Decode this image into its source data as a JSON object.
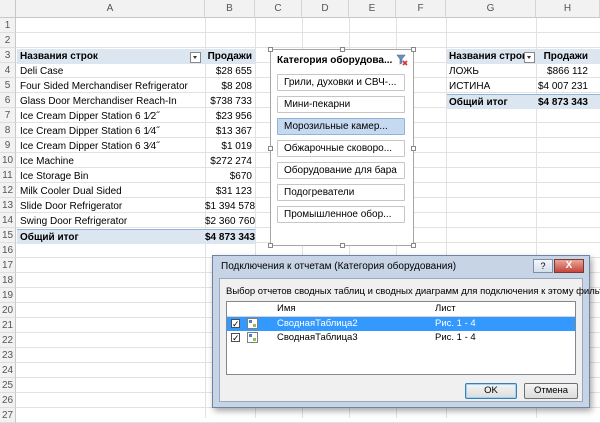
{
  "columns": [
    "A",
    "B",
    "C",
    "D",
    "E",
    "F",
    "G",
    "H"
  ],
  "rows": [
    "1",
    "2",
    "3",
    "4",
    "5",
    "6",
    "7",
    "8",
    "9",
    "10",
    "11",
    "12",
    "13",
    "14",
    "15",
    "16",
    "17",
    "18",
    "19",
    "20",
    "21",
    "22",
    "23",
    "24",
    "25",
    "26",
    "27"
  ],
  "pivot1": {
    "header_label": "Названия строк",
    "header_value": "Продажи",
    "items": [
      {
        "label": "Deli Case",
        "value": "$28 655"
      },
      {
        "label": "Four Sided Merchandiser Refrigerator",
        "value": "$8 208"
      },
      {
        "label": "Glass Door Merchandiser Reach-In",
        "value": "$738 733"
      },
      {
        "label": "Ice Cream Dipper Station 6 1⁄2˝",
        "value": "$23 956"
      },
      {
        "label": "Ice Cream Dipper Station 6 1⁄4˝",
        "value": "$13 367"
      },
      {
        "label": "Ice Cream Dipper Station 6 3⁄4˝",
        "value": "$1 019"
      },
      {
        "label": "Ice Machine",
        "value": "$272 274"
      },
      {
        "label": "Ice Storage Bin",
        "value": "$670"
      },
      {
        "label": "Milk Cooler Dual Sided",
        "value": "$31 123"
      },
      {
        "label": "Slide Door Refrigerator",
        "value": "$1 394 578"
      },
      {
        "label": "Swing Door Refrigerator",
        "value": "$2 360 760"
      }
    ],
    "total_label": "Общий итог",
    "total_value": "$4 873 343"
  },
  "pivot2": {
    "header_label": "Названия строк",
    "header_value": "Продажи",
    "items": [
      {
        "label": "ЛОЖЬ",
        "value": "$866 112"
      },
      {
        "label": "ИСТИНА",
        "value": "$4 007 231"
      }
    ],
    "total_label": "Общий итог",
    "total_value": "$4 873 343"
  },
  "slicer": {
    "title": "Категория оборудова...",
    "items": [
      {
        "label": "Грили, духовки и СВЧ-...",
        "selected": false
      },
      {
        "label": "Мини-пекарни",
        "selected": false
      },
      {
        "label": "Морозильные камер...",
        "selected": true
      },
      {
        "label": "Обжарочные сковоро...",
        "selected": false
      },
      {
        "label": "Оборудование для бара",
        "selected": false
      },
      {
        "label": "Подогреватели",
        "selected": false
      },
      {
        "label": "Промышленное обор...",
        "selected": false
      }
    ]
  },
  "dialog": {
    "title": "Подключения к отчетам (Категория оборудования)",
    "help_label": "?",
    "close_label": "X",
    "instruction": "Выбор отчетов сводных таблиц и сводных диаграмм для подключения к этому фильтру",
    "col_name": "Имя",
    "col_sheet": "Лист",
    "reports": [
      {
        "name": "СводнаяТаблица2",
        "sheet": "Рис. 1 - 4",
        "checked": true,
        "selected": true
      },
      {
        "name": "СводнаяТаблица3",
        "sheet": "Рис. 1 - 4",
        "checked": true,
        "selected": false
      }
    ],
    "ok_label": "OK",
    "cancel_label": "Отмена"
  },
  "colors": {
    "pivot_header": "#dce6f1",
    "slicer_selected": "#c5d9f1",
    "list_selection": "#3399ff",
    "dialog_frame": "#c6d4e6"
  }
}
